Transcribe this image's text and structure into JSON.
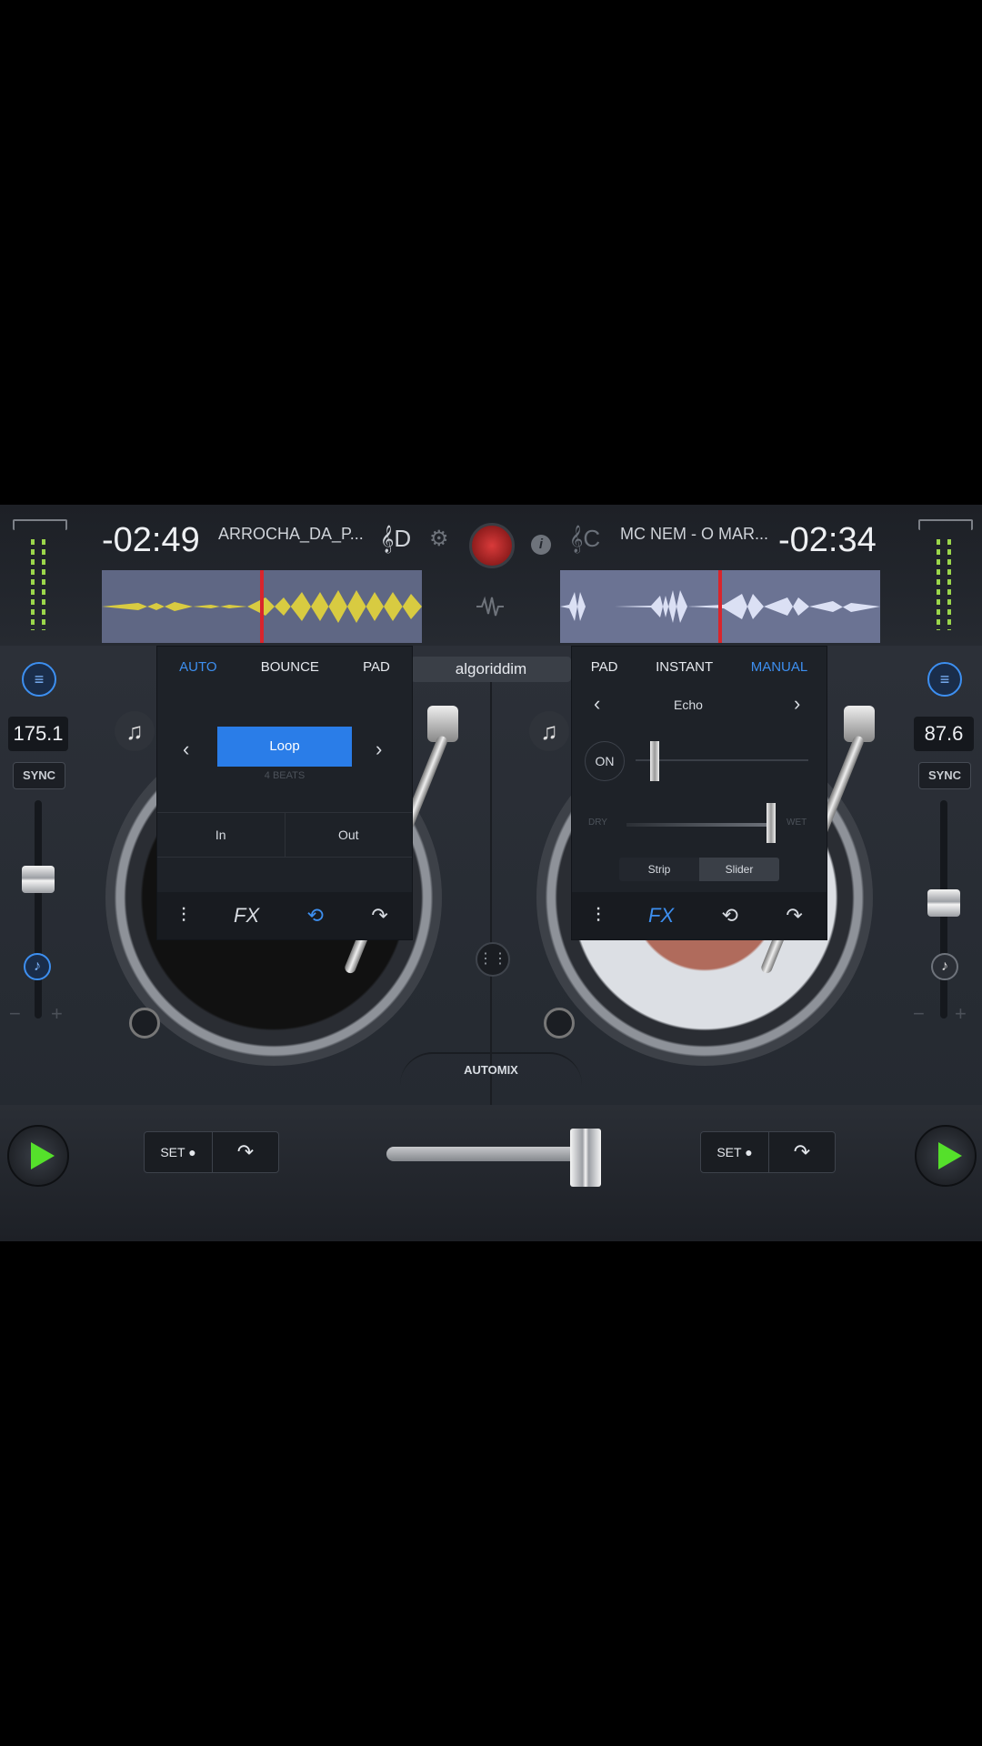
{
  "left_deck": {
    "time": "-02:49",
    "title": "ARROCHA_DA_P...",
    "key": "𝄞D",
    "bpm": "175.1",
    "sync": "SYNC",
    "loop_panel": {
      "tabs": [
        "AUTO",
        "BOUNCE",
        "PAD"
      ],
      "active_tab": "AUTO",
      "loop_label": "Loop",
      "loop_sub": "4 BEATS",
      "in_label": "In",
      "out_label": "Out"
    },
    "fx_label": "FX",
    "set_label": "SET ●"
  },
  "right_deck": {
    "time": "-02:34",
    "title": "MC NEM - O MAR...",
    "key": "𝄞C",
    "bpm": "87.6",
    "sync": "SYNC",
    "fx_panel": {
      "tabs": [
        "PAD",
        "INSTANT",
        "MANUAL"
      ],
      "active_tab": "MANUAL",
      "effect_name": "Echo",
      "on_label": "ON",
      "dry_label": "DRY",
      "wet_label": "WET",
      "strip_label": "Strip",
      "slider_label": "Slider"
    },
    "fx_label": "FX",
    "set_label": "SET ●"
  },
  "center": {
    "brand": "algoriddim",
    "automix": "AUTOMIX"
  },
  "colors": {
    "accent": "#3d8ff0",
    "play": "#55e02b",
    "record": "#d93a3a",
    "left_wave": "#e6d63a",
    "right_wave": "#e8ecff"
  },
  "icons": {
    "settings": "gear-icon",
    "info": "info-icon",
    "waveform_toggle": "waveform-icon",
    "grid": "grid-icon",
    "library": "music-note-icon"
  }
}
